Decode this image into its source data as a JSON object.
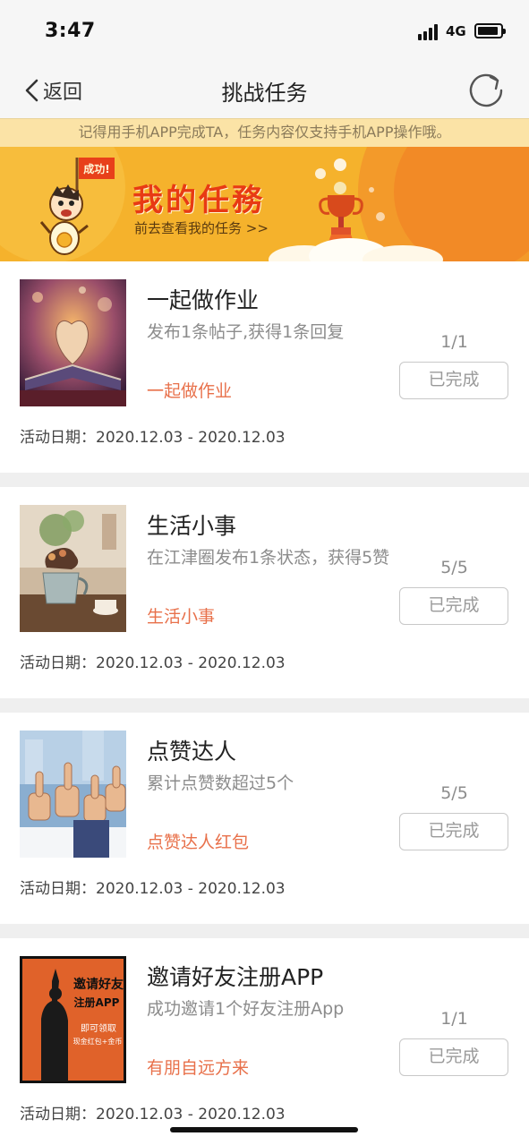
{
  "status_bar": {
    "time": "3:47",
    "network": "4G",
    "icons": [
      "signal-icon",
      "battery-icon"
    ]
  },
  "nav": {
    "back_label": "返回",
    "title": "挑战任务",
    "icons": [
      "chevron-left-icon",
      "refresh-icon"
    ]
  },
  "notice": "记得用手机APP完成TA，任务内容仅支持手机APP操作哦。",
  "banner": {
    "badge": "成功!",
    "title": "我的任務",
    "link": "前去查看我的任务 >>"
  },
  "tasks": [
    {
      "name": "一起做作业",
      "description": "发布1条帖子,获得1条回复",
      "reward": "一起做作业",
      "progress": "1/1",
      "button": "已完成",
      "dates": "活动日期：2020.12.03 - 2020.12.03",
      "thumb": "book-heart-image"
    },
    {
      "name": "生活小事",
      "description": "在江津圈发布1条状态，获得5赞",
      "reward": "生活小事",
      "progress": "5/5",
      "button": "已完成",
      "dates": "活动日期：2020.12.03 - 2020.12.03",
      "thumb": "teapot-cafe-image"
    },
    {
      "name": "点赞达人",
      "description": "累计点赞数超过5个",
      "reward": "点赞达人红包",
      "progress": "5/5",
      "button": "已完成",
      "dates": "活动日期：2020.12.03 - 2020.12.03",
      "thumb": "thumbs-up-image"
    },
    {
      "name": "邀请好友注册APP",
      "description": "成功邀请1个好友注册App",
      "reward": "有朋自远方来",
      "progress": "1/1",
      "button": "已完成",
      "dates": "活动日期：2020.12.03 - 2020.12.03",
      "thumb": "invite-poster-image",
      "poster": {
        "line1": "邀请好友",
        "line2": "注册APP",
        "line3": "即可领取",
        "line4": "现金红包+金币"
      }
    }
  ],
  "colors": {
    "accent": "#e8704a",
    "notice_bg": "#fbe3a6",
    "banner_bg": "#f5b22c"
  }
}
